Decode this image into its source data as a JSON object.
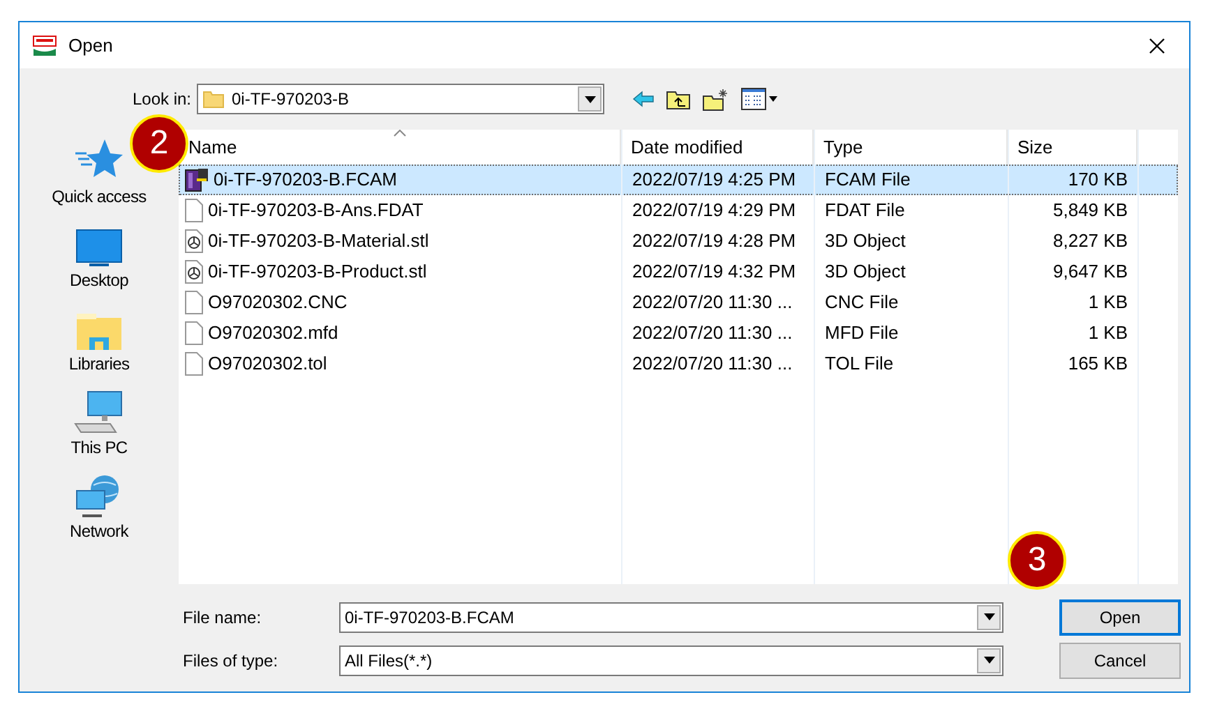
{
  "window": {
    "title": "Open"
  },
  "look_in": {
    "label": "Look in:",
    "value": "0i-TF-970203-B"
  },
  "sidebar": [
    {
      "label": "Quick access",
      "kind": "star"
    },
    {
      "label": "Desktop",
      "kind": "desktop"
    },
    {
      "label": "Libraries",
      "kind": "libraries"
    },
    {
      "label": "This PC",
      "kind": "pc"
    },
    {
      "label": "Network",
      "kind": "network"
    }
  ],
  "columns": [
    "Name",
    "Date modified",
    "Type",
    "Size"
  ],
  "files": [
    {
      "name": "0i-TF-970203-B.FCAM",
      "date": "2022/07/19 4:25 PM",
      "type": "FCAM File",
      "size": "170 KB",
      "kind": "fcam",
      "selected": true
    },
    {
      "name": "0i-TF-970203-B-Ans.FDAT",
      "date": "2022/07/19 4:29 PM",
      "type": "FDAT File",
      "size": "5,849 KB",
      "kind": "blank",
      "selected": false
    },
    {
      "name": "0i-TF-970203-B-Material.stl",
      "date": "2022/07/19 4:28 PM",
      "type": "3D Object",
      "size": "8,227 KB",
      "kind": "model",
      "selected": false
    },
    {
      "name": "0i-TF-970203-B-Product.stl",
      "date": "2022/07/19 4:32 PM",
      "type": "3D Object",
      "size": "9,647 KB",
      "kind": "model",
      "selected": false
    },
    {
      "name": "O97020302.CNC",
      "date": "2022/07/20 11:30 ...",
      "type": "CNC File",
      "size": "1 KB",
      "kind": "blank",
      "selected": false
    },
    {
      "name": "O97020302.mfd",
      "date": "2022/07/20 11:30 ...",
      "type": "MFD File",
      "size": "1 KB",
      "kind": "blank",
      "selected": false
    },
    {
      "name": "O97020302.tol",
      "date": "2022/07/20 11:30 ...",
      "type": "TOL File",
      "size": "165 KB",
      "kind": "blank",
      "selected": false
    }
  ],
  "file_name": {
    "label": "File name:",
    "value": "0i-TF-970203-B.FCAM"
  },
  "file_type": {
    "label": "Files of type:",
    "value": "All Files(*.*)"
  },
  "buttons": [
    "Open",
    "Cancel"
  ],
  "callouts": [
    "2",
    "3"
  ]
}
